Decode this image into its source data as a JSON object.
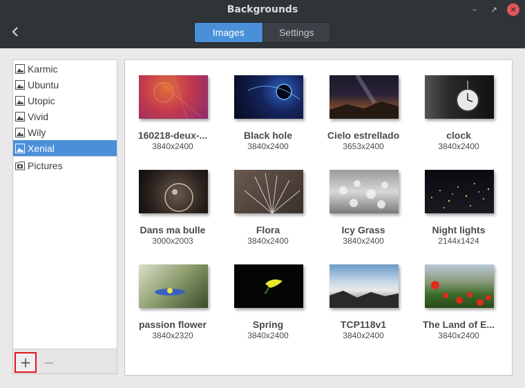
{
  "window": {
    "title": "Backgrounds"
  },
  "header": {
    "tabs": [
      {
        "label": "Images",
        "active": true
      },
      {
        "label": "Settings",
        "active": false
      }
    ]
  },
  "sidebar": {
    "items": [
      {
        "label": "Karmic",
        "icon": "image-folder-icon",
        "selected": false
      },
      {
        "label": "Ubuntu",
        "icon": "image-folder-icon",
        "selected": false
      },
      {
        "label": "Utopic",
        "icon": "image-folder-icon",
        "selected": false
      },
      {
        "label": "Vivid",
        "icon": "image-folder-icon",
        "selected": false
      },
      {
        "label": "Wily",
        "icon": "image-folder-icon",
        "selected": false
      },
      {
        "label": "Xenial",
        "icon": "image-folder-icon",
        "selected": true
      }
    ],
    "places": [
      {
        "label": "Pictures",
        "icon": "pictures-folder-icon"
      }
    ],
    "toolbar": {
      "add_label": "+",
      "remove_label": "−"
    }
  },
  "wallpapers": [
    {
      "name": "160218-deux-...",
      "size": "3840x2400"
    },
    {
      "name": "Black hole",
      "size": "3840x2400"
    },
    {
      "name": "Cielo estrellado",
      "size": "3653x2400"
    },
    {
      "name": "clock",
      "size": "3840x2400"
    },
    {
      "name": "Dans ma bulle",
      "size": "3000x2003"
    },
    {
      "name": "Flora",
      "size": "3840x2400"
    },
    {
      "name": "Icy Grass",
      "size": "3840x2400"
    },
    {
      "name": "Night lights",
      "size": "2144x1424"
    },
    {
      "name": "passion flower",
      "size": "3840x2320"
    },
    {
      "name": "Spring",
      "size": "3840x2400"
    },
    {
      "name": "TCP118v1",
      "size": "3840x2400"
    },
    {
      "name": "The Land of E...",
      "size": "3840x2400"
    }
  ],
  "colors": {
    "accent": "#4a90d9",
    "headerbar": "#2f3439",
    "close": "#e4555b",
    "highlight": "#e0141e"
  }
}
